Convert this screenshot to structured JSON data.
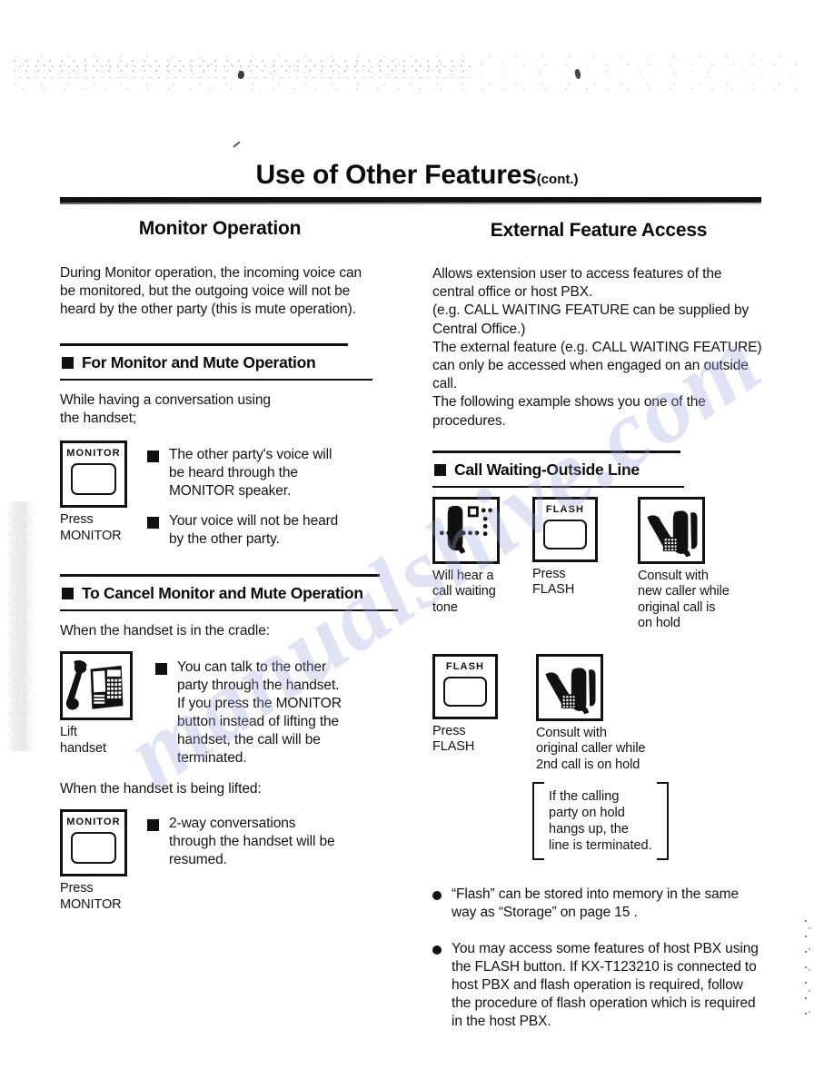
{
  "document": {
    "title": "Use of Other Features",
    "title_suffix": "(cont.)"
  },
  "colors": {
    "ink": "#111111",
    "watermark": "#9aa6d8",
    "paper": "#ffffff"
  },
  "watermark": {
    "text": "manualshive.com"
  },
  "left_column": {
    "heading": "Monitor Operation",
    "intro": "During Monitor operation, the incoming voice can be monitored, but the outgoing voice will not be heard by the other party (this is mute operation).",
    "sections": [
      {
        "header": "For Monitor and Mute Operation",
        "lead": "While having a conversation using\n the handset;",
        "figure": {
          "key_label": "MONITOR",
          "caption": "Press\nMONITOR"
        },
        "bullets": [
          "The other party's voice will\nbe heard through the\nMONITOR speaker.",
          "Your voice will not be heard\nby the other party."
        ]
      },
      {
        "header": "To Cancel Monitor and Mute Operation",
        "step_one": {
          "lead": "When the handset is in the cradle:",
          "figure": {
            "icon": "desk-phone-with-lifted-handset-icon",
            "caption": "Lift\nhandset"
          },
          "bullets": [
            "You can talk to the other\nparty through the handset.\nIf you press the MONITOR\nbutton instead of lifting the\nhandset, the call will be\nterminated."
          ]
        },
        "step_two": {
          "lead": "When the handset is being lifted:",
          "figure": {
            "key_label": "MONITOR",
            "caption": "Press\nMONITOR"
          },
          "bullets": [
            "2-way conversations\nthrough the handset will be\nresumed."
          ]
        }
      }
    ]
  },
  "right_column": {
    "heading": "External Feature Access",
    "intro": "Allows extension user to access features of the central office or host PBX.\n(e.g. CALL WAITING FEATURE can be supplied by Central Office.)\nThe external feature (e.g. CALL WAITING FEATURE) can only be accessed when engaged on an outside call.\nThe following example shows you one of the procedures.",
    "section": {
      "header": "Call Waiting-Outside Line",
      "row_one": [
        {
          "icon": "handset-with-call-waiting-tone-icon",
          "caption": "Will hear a\ncall waiting\ntone"
        },
        {
          "icon": "flash-key-icon",
          "key_label": "FLASH",
          "caption": "Press\nFLASH"
        },
        {
          "icon": "two-handsets-consult-icon",
          "caption": "Consult with\nnew caller while\noriginal call is\non hold"
        }
      ],
      "row_two": [
        {
          "icon": "flash-key-icon",
          "key_label": "FLASH",
          "caption": "Press\nFLASH"
        },
        {
          "icon": "two-handsets-consult-icon",
          "caption": "Consult with\noriginal caller while\n2nd call is on hold"
        }
      ],
      "note": "If the calling\nparty on hold\nhangs up, the\nline is terminated."
    },
    "notes": [
      "“Flash” can be stored into memory in the same way as “Storage” on page 15 .",
      "You may access some features of host PBX using the FLASH button. If KX-T123210 is connected to host PBX and flash operation is required, follow the procedure of flash operation which is required in the host PBX."
    ]
  }
}
